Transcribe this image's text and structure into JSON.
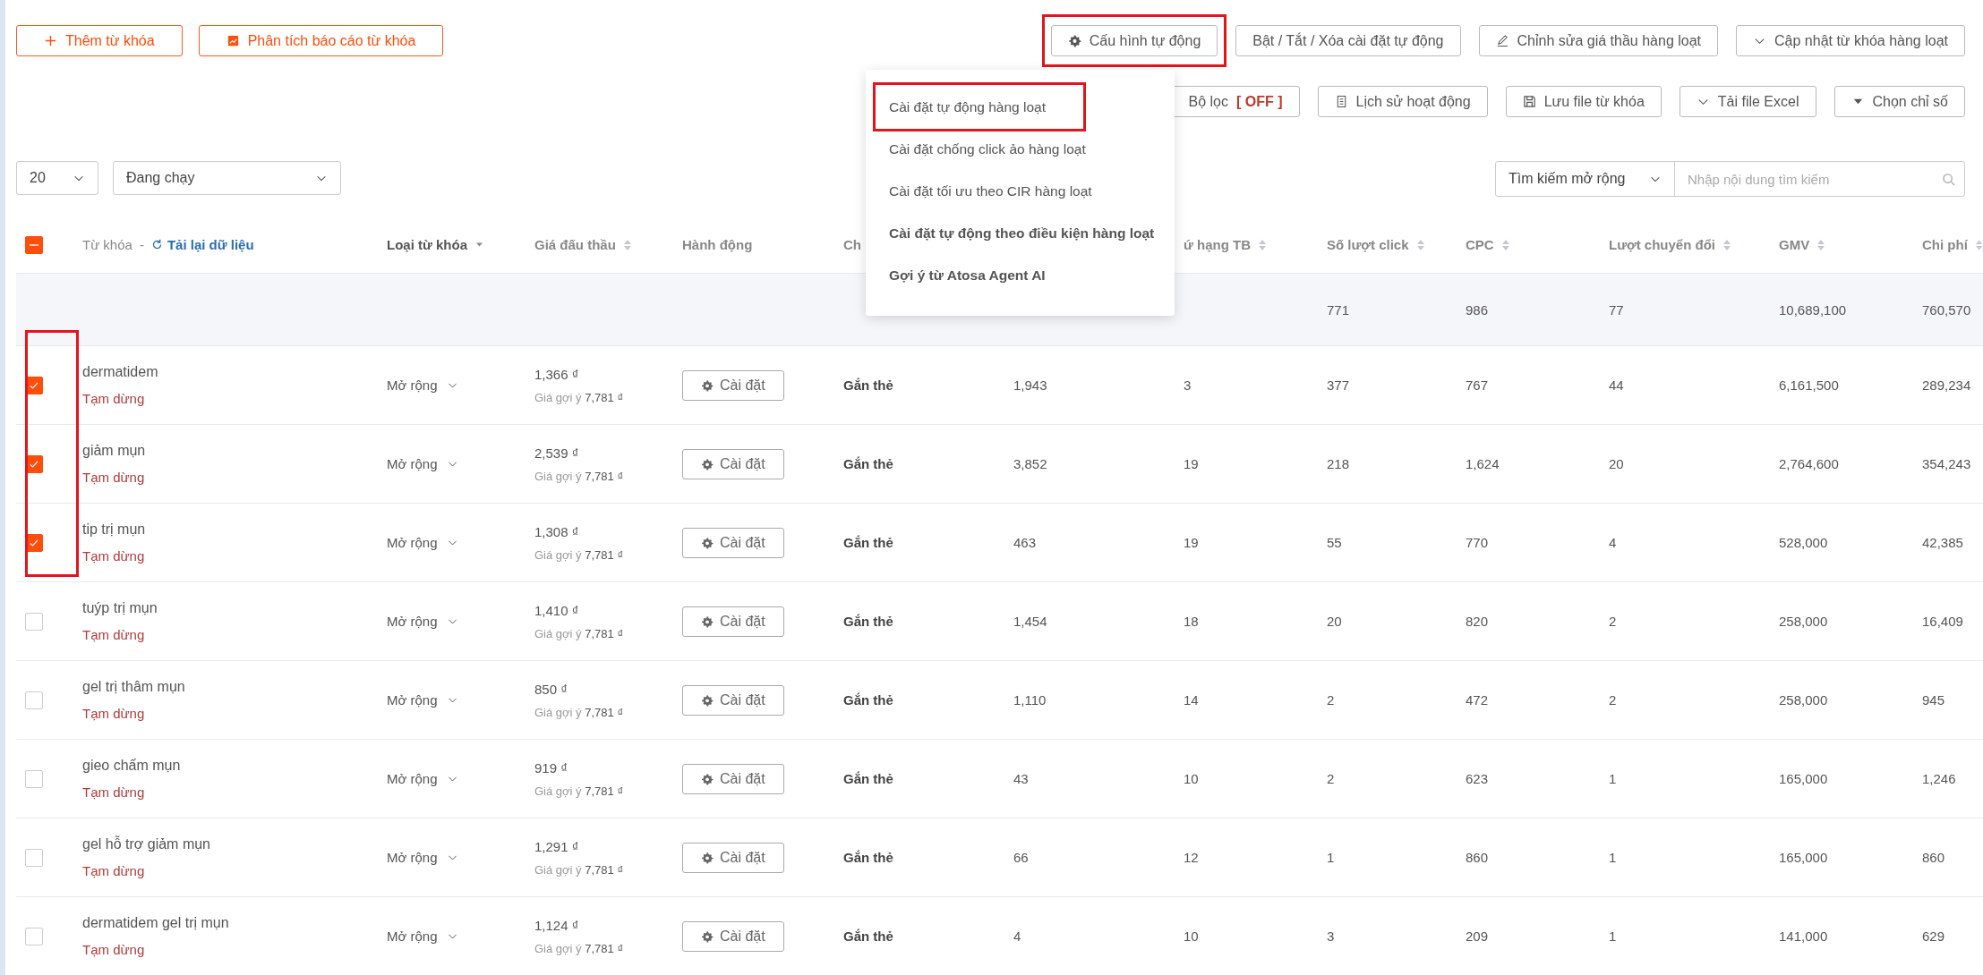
{
  "toolbar_left": [
    {
      "label": "Thêm từ khóa"
    },
    {
      "label": "Phân tích báo cáo từ khóa"
    }
  ],
  "toolbar_right": [
    {
      "label": "Cấu hình tự động",
      "highlighted": true
    },
    {
      "label": "Bật / Tắt / Xóa cài đặt tự động",
      "highlighted": false
    },
    {
      "label": "Chỉnh sửa giá thầu hàng loạt",
      "highlighted": false
    },
    {
      "label": "Cập nhật từ khóa hàng loạt",
      "highlighted": false
    }
  ],
  "toolbar_second": [
    {
      "label": "Bộ lọc",
      "flag": "[ OFF ]"
    },
    {
      "label": "Lịch sử hoạt động"
    },
    {
      "label": "Lưu file từ khóa"
    },
    {
      "label": "Tải file Excel"
    },
    {
      "label": "Chọn chỉ số"
    }
  ],
  "page_size": {
    "value": "20"
  },
  "status_filter": {
    "value": "Đang chạy"
  },
  "search": {
    "scope": "Tìm kiếm mở rộng",
    "placeholder": "Nhập nội dung tìm kiếm"
  },
  "menu": {
    "items": [
      {
        "label": "Cài đặt tự động hàng loạt",
        "bold": false,
        "highlighted": true
      },
      {
        "label": "Cài đặt chống click ảo hàng loạt",
        "bold": false,
        "highlighted": false
      },
      {
        "label": "Cài đặt tối ưu theo CIR hàng loạt",
        "bold": false,
        "highlighted": false
      },
      {
        "label": "Cài đặt tự động theo điều kiện hàng loạt",
        "bold": true,
        "highlighted": false
      },
      {
        "label": "Gợi ý từ Atosa Agent AI",
        "bold": true,
        "highlighted": false
      }
    ]
  },
  "table": {
    "select_all": {
      "indeterminate": true
    },
    "columns": [
      {
        "kind": "keyword",
        "label": "Từ khóa",
        "separator": "-",
        "link": "Tải lại dữ liệu"
      },
      {
        "kind": "filter",
        "label": "Loại từ khóa"
      },
      {
        "kind": "sort",
        "label": "Giá đấu thầu"
      },
      {
        "kind": "plain",
        "label": "Hành động"
      },
      {
        "kind": "plain",
        "label": "Ch"
      },
      {
        "kind": "blank"
      },
      {
        "kind": "sort",
        "label": "ứ hạng TB"
      },
      {
        "kind": "sort",
        "label": "Số lượt click"
      },
      {
        "kind": "sort",
        "label": "CPC"
      },
      {
        "kind": "sort",
        "label": "Lượt chuyển đổi"
      },
      {
        "kind": "sort",
        "label": "GMV"
      },
      {
        "kind": "sort",
        "label": "Chi phí"
      }
    ],
    "summary": {
      "clicks": "771",
      "cpc": "986",
      "conversions": "77",
      "gmv": "10,689,100",
      "cost": "760,570"
    },
    "rows": [
      {
        "checked": true,
        "highlighted": true,
        "keyword": "dermatidem",
        "status": "Tạm dừng",
        "match_type": "Mở rộng",
        "bid": "1,366 ₫",
        "suggest_label": "Giá gợi ý",
        "suggest_value": "7,781 ₫",
        "action": "Cài đặt",
        "tag": "Gắn thẻ",
        "column_6": "1,943",
        "rank": "3",
        "clicks": "377",
        "cpc": "767",
        "conversions": "44",
        "gmv": "6,161,500",
        "cost": "289,234"
      },
      {
        "checked": true,
        "highlighted": true,
        "keyword": "giảm mụn",
        "status": "Tạm dừng",
        "match_type": "Mở rộng",
        "bid": "2,539 ₫",
        "suggest_label": "Giá gợi ý",
        "suggest_value": "7,781 ₫",
        "action": "Cài đặt",
        "tag": "Gắn thẻ",
        "column_6": "3,852",
        "rank": "19",
        "clicks": "218",
        "cpc": "1,624",
        "conversions": "20",
        "gmv": "2,764,600",
        "cost": "354,243"
      },
      {
        "checked": true,
        "highlighted": true,
        "keyword": "tip trị mụn",
        "status": "Tạm dừng",
        "match_type": "Mở rộng",
        "bid": "1,308 ₫",
        "suggest_label": "Giá gợi ý",
        "suggest_value": "7,781 ₫",
        "action": "Cài đặt",
        "tag": "Gắn thẻ",
        "column_6": "463",
        "rank": "19",
        "clicks": "55",
        "cpc": "770",
        "conversions": "4",
        "gmv": "528,000",
        "cost": "42,385"
      },
      {
        "checked": false,
        "highlighted": false,
        "keyword": "tuýp trị mụn",
        "status": "Tạm dừng",
        "match_type": "Mở rộng",
        "bid": "1,410 ₫",
        "suggest_label": "Giá gợi ý",
        "suggest_value": "7,781 ₫",
        "action": "Cài đặt",
        "tag": "Gắn thẻ",
        "column_6": "1,454",
        "rank": "18",
        "clicks": "20",
        "cpc": "820",
        "conversions": "2",
        "gmv": "258,000",
        "cost": "16,409"
      },
      {
        "checked": false,
        "highlighted": false,
        "keyword": "gel trị thâm mụn",
        "status": "Tạm dừng",
        "match_type": "Mở rộng",
        "bid": "850 ₫",
        "suggest_label": "Giá gợi ý",
        "suggest_value": "7,781 ₫",
        "action": "Cài đặt",
        "tag": "Gắn thẻ",
        "column_6": "1,110",
        "rank": "14",
        "clicks": "2",
        "cpc": "472",
        "conversions": "2",
        "gmv": "258,000",
        "cost": "945"
      },
      {
        "checked": false,
        "highlighted": false,
        "keyword": "gieo chấm mụn",
        "status": "Tạm dừng",
        "match_type": "Mở rộng",
        "bid": "919 ₫",
        "suggest_label": "Giá gợi ý",
        "suggest_value": "7,781 ₫",
        "action": "Cài đặt",
        "tag": "Gắn thẻ",
        "column_6": "43",
        "rank": "10",
        "clicks": "2",
        "cpc": "623",
        "conversions": "1",
        "gmv": "165,000",
        "cost": "1,246"
      },
      {
        "checked": false,
        "highlighted": false,
        "keyword": "gel hỗ trợ giảm mụn",
        "status": "Tạm dừng",
        "match_type": "Mở rộng",
        "bid": "1,291 ₫",
        "suggest_label": "Giá gợi ý",
        "suggest_value": "7,781 ₫",
        "action": "Cài đặt",
        "tag": "Gắn thẻ",
        "column_6": "66",
        "rank": "12",
        "clicks": "1",
        "cpc": "860",
        "conversions": "1",
        "gmv": "165,000",
        "cost": "860"
      },
      {
        "checked": false,
        "highlighted": false,
        "keyword": "dermatidem gel trị mụn",
        "status": "Tạm dừng",
        "match_type": "Mở rộng",
        "bid": "1,124 ₫",
        "suggest_label": "Giá gợi ý",
        "suggest_value": "7,781 ₫",
        "action": "Cài đặt",
        "tag": "Gắn thẻ",
        "column_6": "4",
        "rank": "10",
        "clicks": "3",
        "cpc": "209",
        "conversions": "1",
        "gmv": "141,000",
        "cost": "629"
      }
    ]
  }
}
